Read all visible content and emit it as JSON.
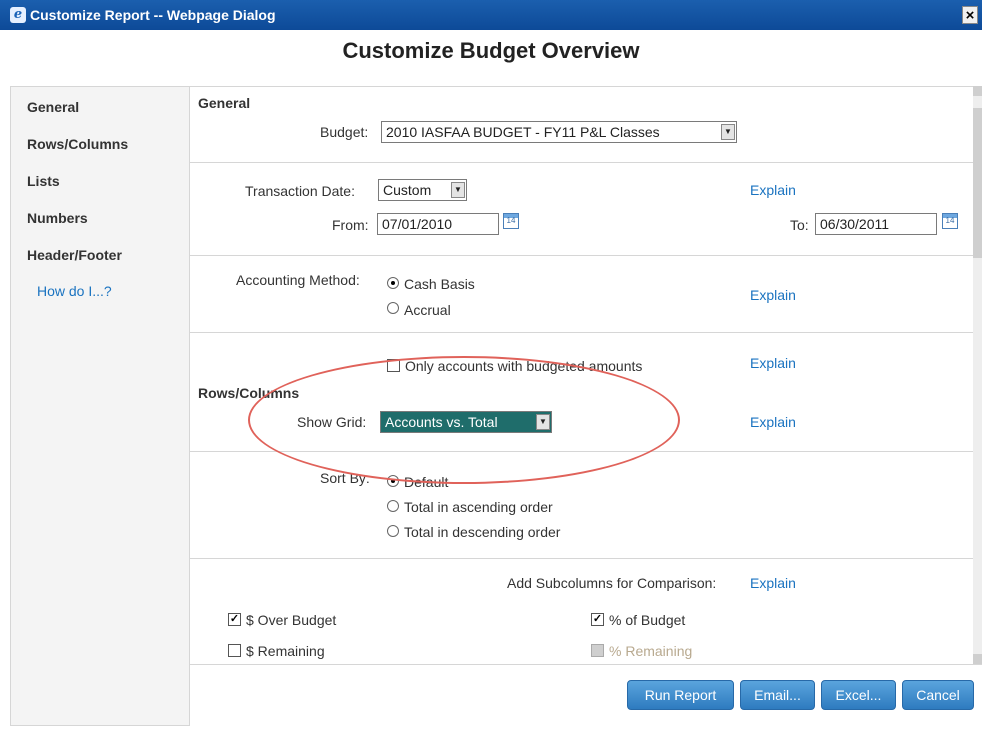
{
  "window": {
    "title": "Customize Report -- Webpage Dialog",
    "close_label": "×"
  },
  "heading": "Customize Budget Overview",
  "sidebar": {
    "items": [
      "General",
      "Rows/Columns",
      "Lists",
      "Numbers",
      "Header/Footer"
    ],
    "help_link": "How do I...?"
  },
  "general": {
    "section_title": "General",
    "budget_label": "Budget:",
    "budget_value": "2010 IASFAA BUDGET - FY11 P&L Classes",
    "transaction_date_label": "Transaction Date:",
    "transaction_date_value": "Custom",
    "explain": "Explain",
    "from_label": "From:",
    "from_value": "07/01/2010",
    "to_label": "To:",
    "to_value": "06/30/2011",
    "calendar_text": "14",
    "accounting_method_label": "Accounting Method:",
    "cash_basis": "Cash Basis",
    "accrual": "Accrual",
    "only_budgeted": "Only accounts with budgeted amounts"
  },
  "rows_columns": {
    "section_title": "Rows/Columns",
    "show_grid_label": "Show Grid:",
    "show_grid_value": "Accounts vs. Total",
    "sort_by_label": "Sort By:",
    "sort_default": "Default",
    "sort_asc": "Total in ascending order",
    "sort_desc": "Total in descending order"
  },
  "subcolumns": {
    "heading": "Add Subcolumns for Comparison:",
    "over_budget": "$ Over Budget",
    "pct_of_budget": "% of Budget",
    "remaining": "$ Remaining",
    "pct_remaining": "% Remaining",
    "check_mark": "✓"
  },
  "buttons": {
    "run": "Run Report",
    "email": "Email...",
    "excel": "Excel...",
    "cancel": "Cancel"
  },
  "colors": {
    "title_bar": "#0d4a98",
    "button": "#2e7bbf",
    "link": "#1a73c0",
    "highlight": "#1f6d6b",
    "annotation": "#e0625a"
  }
}
